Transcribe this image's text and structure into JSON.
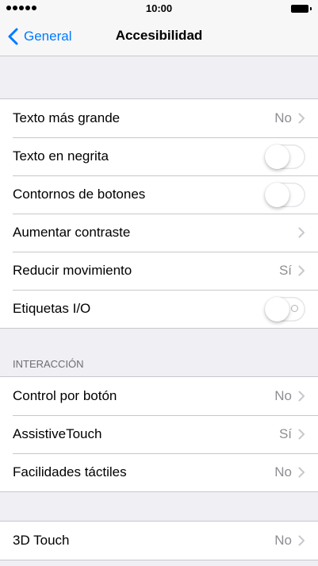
{
  "status_bar": {
    "time": "10:00",
    "signal_dots": 5
  },
  "nav": {
    "back_label": "General",
    "title": "Accesibilidad"
  },
  "colors": {
    "accent": "#007aff",
    "background": "#efeff4",
    "separator": "#c8c7cc",
    "secondary_text": "#8e8e93"
  },
  "groups": [
    {
      "header": "",
      "rows": [
        {
          "label": "Texto más grande",
          "value": "No",
          "accessory": "chevron"
        },
        {
          "label": "Texto en negrita",
          "accessory": "toggle",
          "on": false
        },
        {
          "label": "Contornos de botones",
          "accessory": "toggle",
          "on": false
        },
        {
          "label": "Aumentar contraste",
          "value": "",
          "accessory": "chevron"
        },
        {
          "label": "Reducir movimiento",
          "value": "Sí",
          "accessory": "chevron"
        },
        {
          "label": "Etiquetas I/O",
          "accessory": "toggle",
          "on": false,
          "io_labels": true
        }
      ]
    },
    {
      "header": "INTERACCIÓN",
      "rows": [
        {
          "label": "Control por botón",
          "value": "No",
          "accessory": "chevron"
        },
        {
          "label": "AssistiveTouch",
          "value": "Sí",
          "accessory": "chevron"
        },
        {
          "label": "Facilidades táctiles",
          "value": "No",
          "accessory": "chevron"
        }
      ]
    },
    {
      "header": "",
      "rows": [
        {
          "label": "3D Touch",
          "value": "No",
          "accessory": "chevron"
        }
      ]
    }
  ]
}
